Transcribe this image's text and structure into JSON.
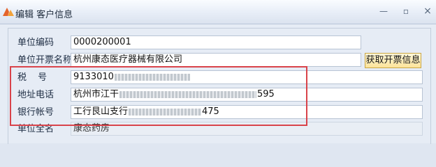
{
  "window": {
    "title": "编辑 客户信息",
    "controls": {
      "minimize": "—",
      "maximize": "▫",
      "close": "×"
    }
  },
  "form": {
    "unit_code": {
      "label": "单位编码",
      "value": "0000200001"
    },
    "invoice_name": {
      "label": "单位开票名称",
      "value": "杭州康态医疗器械有限公司"
    },
    "tax_no": {
      "label": "税  号",
      "value_visible": "9133010",
      "value_tail": ""
    },
    "address_phone": {
      "label": "地址电话",
      "value_prefix": "杭州市江干",
      "value_tail": "595"
    },
    "bank_account": {
      "label": "银行帐号",
      "value_prefix": "工行艮山支行",
      "value_tail": "475"
    },
    "full_name": {
      "label": "单位全名",
      "value": "康态药房"
    }
  },
  "buttons": {
    "fetch_invoice_info": "获取开票信息"
  },
  "colors": {
    "highlight": "#d9434a",
    "button_bg": "#fde49a",
    "titlebar": "#e7edf7"
  },
  "icons": {
    "app": "app-logo-icon"
  }
}
